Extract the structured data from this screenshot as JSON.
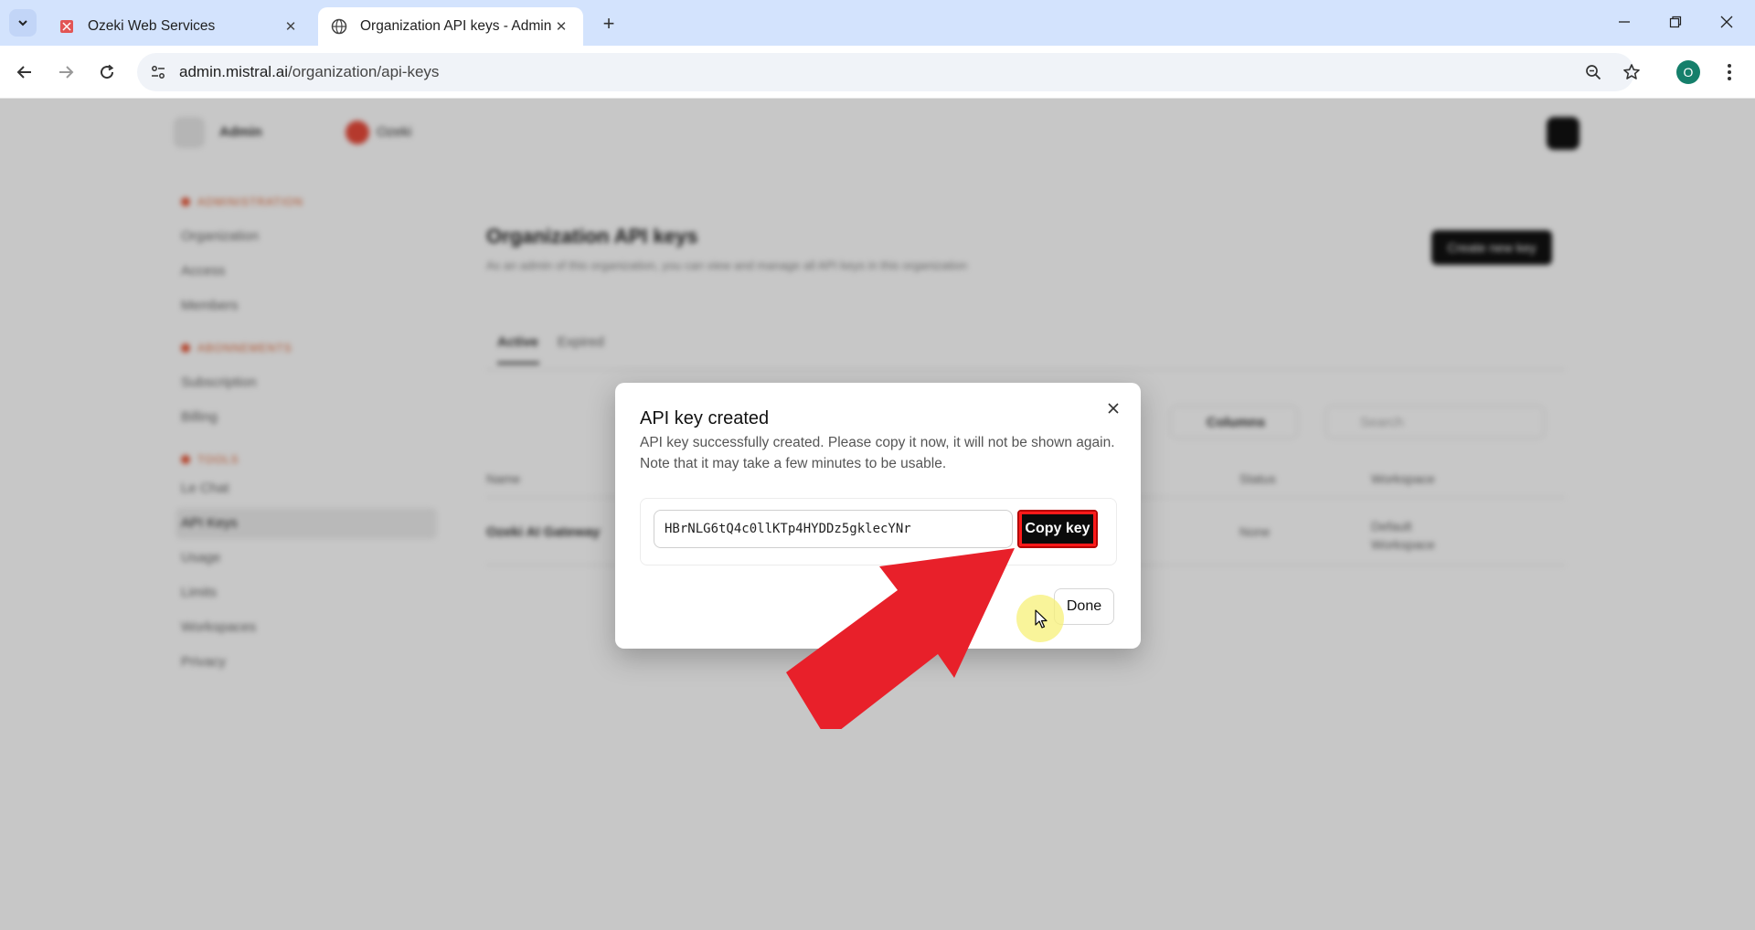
{
  "browser": {
    "tabs": [
      {
        "title": "Ozeki Web Services",
        "active": false,
        "favicon": "ozeki-icon"
      },
      {
        "title": "Organization API keys - Admin",
        "active": true,
        "favicon": "globe-icon"
      }
    ],
    "url_host": "admin.mistral.ai",
    "url_path": "/organization/api-keys",
    "profile_initial": "O"
  },
  "background_page": {
    "header_workspace": "Admin",
    "header_org": "Ozeki",
    "sidebar": [
      {
        "section": "ADMINISTRATION"
      },
      {
        "label": "Organization"
      },
      {
        "label": "Access"
      },
      {
        "label": "Members"
      },
      {
        "section": "ABONNEMENTS"
      },
      {
        "label": "Subscription"
      },
      {
        "label": "Billing"
      },
      {
        "section": "TOOLS"
      },
      {
        "label": "Le Chat"
      },
      {
        "label": "API Keys",
        "selected": true
      },
      {
        "label": "Usage"
      },
      {
        "label": "Limits"
      },
      {
        "label": "Workspaces"
      },
      {
        "label": "Privacy"
      }
    ],
    "page_title": "Organization API keys",
    "page_subtitle": "As an admin of this organization, you can view and manage all API keys in this organization",
    "create_button": "Create new key",
    "tabs": [
      "Active",
      "Expired"
    ],
    "columns_button": "Columns",
    "search_placeholder": "Search",
    "table_headers": [
      "Name",
      "Status",
      "Workspace"
    ],
    "table_row": {
      "name": "Ozeki AI Gateway",
      "status": "None",
      "workspace": "Default Workspace"
    }
  },
  "modal": {
    "title": "API key created",
    "description_line1": "API key successfully created. Please copy it now, it will not be shown again.",
    "description_line2": "Note that it may take a few minutes to be usable.",
    "api_key": "HBrNLG6tQ4c0llKTp4HYDDz5gklecYNr",
    "copy_button": "Copy key",
    "done_button": "Done"
  },
  "colors": {
    "tabstrip": "#d3e3fd",
    "annotation_arrow": "#e8202a",
    "highlight_border": "#ff1a1a",
    "cursor_halo": "#f7f078"
  }
}
